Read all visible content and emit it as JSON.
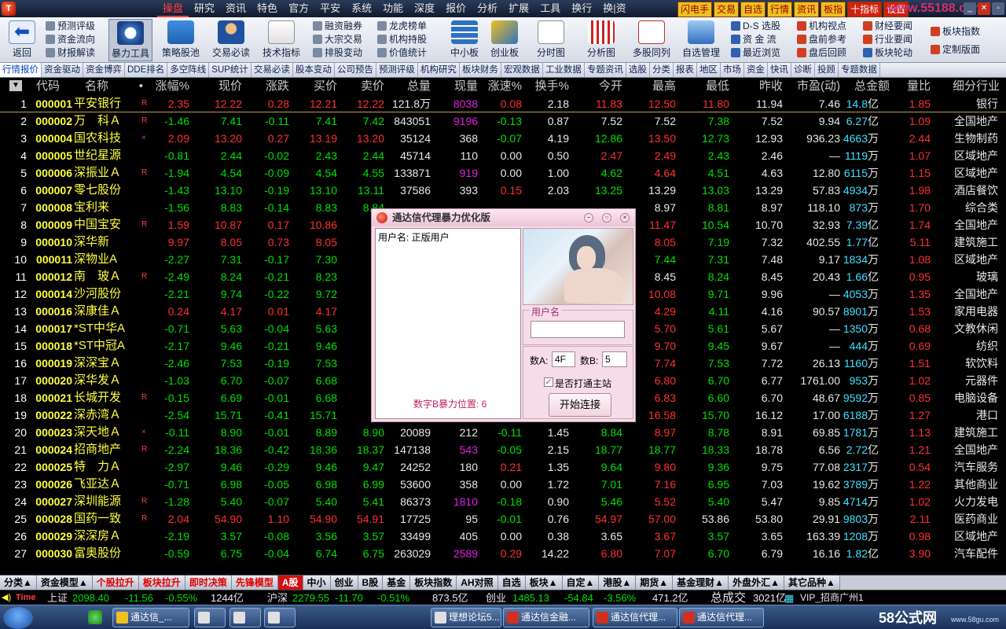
{
  "menu": {
    "items": [
      "操盘",
      "研究",
      "资讯",
      "特色",
      "官方",
      "平安",
      "系统",
      "功能",
      "深度",
      "报价",
      "分析",
      "扩展",
      "工具",
      "换行",
      "换|资"
    ],
    "quick": [
      "闪电手",
      "交易",
      "自选",
      "行情",
      "资讯",
      "板指",
      "十指标",
      "设置"
    ],
    "watermark": "www.55188.com"
  },
  "toolbar": {
    "back": "返回",
    "violence": "暴力工具",
    "strategy": "策略股池",
    "trade": "交易必读",
    "tech": "技术指标",
    "small1": [
      "预测评级",
      "资金流向",
      "财报解读"
    ],
    "small2": [
      "融资融券",
      "大宗交易",
      "排股变动"
    ],
    "small3": [
      "龙虎榜单",
      "机构持股",
      "价值统计"
    ],
    "zxb": "中小板",
    "cyb": "创业板",
    "fst": "分时图",
    "fxt": "分析图",
    "dgtl": "多股同列",
    "zxgl": "自选管理",
    "small4": [
      "D-S 选股",
      "资 金 流",
      "最近浏览"
    ],
    "small5": [
      "机构视点",
      "盘前参考",
      "盘后回顾"
    ],
    "small6": [
      "财经要闻",
      "行业要闻",
      "板块轮动"
    ],
    "small7": [
      "板块指数",
      "定制版面"
    ]
  },
  "tabs": [
    "行情报价",
    "资金驱动",
    "资金博弈",
    "DDE排名",
    "多空阵线",
    "SUP统计",
    "交易必读",
    "股本变动",
    "公司预告",
    "预测评级",
    "机构研究",
    "板块财务",
    "宏观数据",
    "工业数据",
    "专题资讯",
    "选股",
    "分类",
    "报表",
    "地区",
    "市场",
    "资金",
    "快讯",
    "诊断",
    "投顾",
    "专题数据"
  ],
  "table": {
    "headers": [
      "代码",
      "名称",
      "•",
      "涨幅%",
      "现价",
      "涨跌",
      "买价",
      "卖价",
      "总量",
      "现量",
      "涨速%",
      "换手%",
      "今开",
      "最高",
      "最低",
      "昨收",
      "市盈(动)",
      "总金额",
      "量比",
      "细分行业"
    ],
    "rows": [
      {
        "no": "1",
        "code": "000001",
        "name": "平安银行",
        "flag": "R",
        "d": "up",
        "pct": "2.35",
        "price": "12.22",
        "chg": "0.28",
        "bid": "12.21",
        "ask": "12.22",
        "vol": "121.8万",
        "cur": "8038",
        "cc": "mag",
        "spd": "0.08",
        "sc": "up",
        "turn": "2.18",
        "open": "11.83",
        "oc": "up",
        "high": "12.50",
        "hc": "up",
        "low": "11.80",
        "lc": "up",
        "prev": "11.94",
        "pe": "7.46",
        "amt": "14.8",
        "amtu": "亿",
        "qr": "1.85",
        "ind": "银行"
      },
      {
        "no": "2",
        "code": "000002",
        "name": "万　科Ａ",
        "flag": "R",
        "d": "dn",
        "pct": "-1.46",
        "price": "7.41",
        "chg": "-0.11",
        "bid": "7.41",
        "ask": "7.42",
        "vol": "843051",
        "cur": "9196",
        "cc": "mag",
        "spd": "-0.13",
        "sc": "dn",
        "turn": "0.87",
        "open": "7.52",
        "oc": "fl",
        "high": "7.52",
        "hc": "fl",
        "low": "7.38",
        "lc": "dn",
        "prev": "7.52",
        "pe": "9.94",
        "amt": "6.27",
        "amtu": "亿",
        "qr": "1.09",
        "ind": "全国地产"
      },
      {
        "no": "3",
        "code": "000004",
        "name": "国农科技",
        "flag": "×",
        "d": "up",
        "pct": "2.09",
        "price": "13.20",
        "chg": "0.27",
        "bid": "13.19",
        "ask": "13.20",
        "vol": "35124",
        "cur": "368",
        "cc": "fl",
        "spd": "-0.07",
        "sc": "dn",
        "turn": "4.19",
        "open": "12.86",
        "oc": "dn",
        "high": "13.50",
        "hc": "up",
        "low": "12.73",
        "lc": "dn",
        "prev": "12.93",
        "pe": "936.23",
        "amt": "4663",
        "amtu": "万",
        "qr": "2.44",
        "ind": "生物制药"
      },
      {
        "no": "4",
        "code": "000005",
        "name": "世纪星源",
        "flag": "",
        "d": "dn",
        "pct": "-0.81",
        "price": "2.44",
        "chg": "-0.02",
        "bid": "2.43",
        "ask": "2.44",
        "vol": "45714",
        "cur": "110",
        "cc": "fl",
        "spd": "0.00",
        "sc": "fl",
        "turn": "0.50",
        "open": "2.47",
        "oc": "up",
        "high": "2.49",
        "hc": "up",
        "low": "2.43",
        "lc": "dn",
        "prev": "2.46",
        "pe": "—",
        "amt": "1119",
        "amtu": "万",
        "qr": "1.07",
        "ind": "区域地产"
      },
      {
        "no": "5",
        "code": "000006",
        "name": "深振业Ａ",
        "flag": "R",
        "d": "dn",
        "pct": "-1.94",
        "price": "4.54",
        "chg": "-0.09",
        "bid": "4.54",
        "ask": "4.55",
        "vol": "133871",
        "cur": "919",
        "cc": "mag",
        "spd": "0.00",
        "sc": "fl",
        "turn": "1.00",
        "open": "4.62",
        "oc": "dn",
        "high": "4.64",
        "hc": "up",
        "low": "4.51",
        "lc": "dn",
        "prev": "4.63",
        "pe": "12.80",
        "amt": "6115",
        "amtu": "万",
        "qr": "1.15",
        "ind": "区域地产"
      },
      {
        "no": "6",
        "code": "000007",
        "name": "零七股份",
        "flag": "",
        "d": "dn",
        "pct": "-1.43",
        "price": "13.10",
        "chg": "-0.19",
        "bid": "13.10",
        "ask": "13.11",
        "vol": "37586",
        "cur": "393",
        "cc": "fl",
        "spd": "0.15",
        "sc": "up",
        "turn": "2.03",
        "open": "13.25",
        "oc": "dn",
        "high": "13.29",
        "hc": "fl",
        "low": "13.03",
        "lc": "dn",
        "prev": "13.29",
        "pe": "57.83",
        "amt": "4934",
        "amtu": "万",
        "qr": "1.98",
        "ind": "酒店餐饮"
      },
      {
        "no": "7",
        "code": "000008",
        "name": "宝利来",
        "flag": "",
        "d": "dn",
        "pct": "-1.56",
        "price": "8.83",
        "chg": "-0.14",
        "bid": "8.83",
        "ask": "8.84",
        "vol": "",
        "cur": "",
        "cc": "fl",
        "spd": "",
        "sc": "fl",
        "turn": "",
        "open": "",
        "oc": "fl",
        "high": "8.97",
        "hc": "fl",
        "low": "8.81",
        "lc": "dn",
        "prev": "8.97",
        "pe": "118.10",
        "amt": "873",
        "amtu": "万",
        "qr": "1.70",
        "ind": "综合类"
      },
      {
        "no": "8",
        "code": "000009",
        "name": "中国宝安",
        "flag": "R",
        "d": "up",
        "pct": "1.59",
        "price": "10.87",
        "chg": "0.17",
        "bid": "10.86",
        "ask": "",
        "vol": "",
        "cur": "",
        "cc": "fl",
        "spd": "",
        "sc": "fl",
        "turn": "",
        "open": "",
        "oc": "fl",
        "high": "11.47",
        "hc": "up",
        "low": "10.54",
        "lc": "dn",
        "prev": "10.70",
        "pe": "32.93",
        "amt": "7.39",
        "amtu": "亿",
        "qr": "1.74",
        "ind": "全国地产"
      },
      {
        "no": "9",
        "code": "000010",
        "name": "深华新",
        "flag": "",
        "d": "up",
        "pct": "9.97",
        "price": "8.05",
        "chg": "0.73",
        "bid": "8.05",
        "ask": "",
        "vol": "",
        "cur": "",
        "cc": "fl",
        "spd": "",
        "sc": "fl",
        "turn": "",
        "open": "",
        "oc": "fl",
        "high": "8.05",
        "hc": "up",
        "low": "7.19",
        "lc": "dn",
        "prev": "7.32",
        "pe": "402.55",
        "amt": "1.77",
        "amtu": "亿",
        "qr": "5.11",
        "ind": "建筑施工"
      },
      {
        "no": "10",
        "code": "000011",
        "name": "深物业A",
        "flag": "",
        "d": "dn",
        "pct": "-2.27",
        "price": "7.31",
        "chg": "-0.17",
        "bid": "7.30",
        "ask": "",
        "vol": "",
        "cur": "",
        "cc": "fl",
        "spd": "",
        "sc": "fl",
        "turn": "",
        "open": "",
        "oc": "fl",
        "high": "7.44",
        "hc": "dn",
        "low": "7.31",
        "lc": "dn",
        "prev": "7.48",
        "pe": "9.17",
        "amt": "1834",
        "amtu": "万",
        "qr": "1.08",
        "ind": "区域地产"
      },
      {
        "no": "11",
        "code": "000012",
        "name": "南　玻Ａ",
        "flag": "R",
        "d": "dn",
        "pct": "-2.49",
        "price": "8.24",
        "chg": "-0.21",
        "bid": "8.23",
        "ask": "",
        "vol": "",
        "cur": "",
        "cc": "fl",
        "spd": "",
        "sc": "fl",
        "turn": "",
        "open": "",
        "oc": "fl",
        "high": "8.45",
        "hc": "fl",
        "low": "8.24",
        "lc": "dn",
        "prev": "8.45",
        "pe": "20.43",
        "amt": "1.66",
        "amtu": "亿",
        "qr": "0.95",
        "ind": "玻璃"
      },
      {
        "no": "12",
        "code": "000014",
        "name": "沙河股份",
        "flag": "",
        "d": "dn",
        "pct": "-2.21",
        "price": "9.74",
        "chg": "-0.22",
        "bid": "9.72",
        "ask": "",
        "vol": "",
        "cur": "",
        "cc": "fl",
        "spd": "",
        "sc": "fl",
        "turn": "",
        "open": "",
        "oc": "fl",
        "high": "10.08",
        "hc": "up",
        "low": "9.71",
        "lc": "dn",
        "prev": "9.96",
        "pe": "—",
        "amt": "4053",
        "amtu": "万",
        "qr": "1.35",
        "ind": "全国地产"
      },
      {
        "no": "13",
        "code": "000016",
        "name": "深康佳Ａ",
        "flag": "",
        "d": "up",
        "pct": "0.24",
        "price": "4.17",
        "chg": "0.01",
        "bid": "4.17",
        "ask": "",
        "vol": "",
        "cur": "",
        "cc": "fl",
        "spd": "",
        "sc": "fl",
        "turn": "",
        "open": "",
        "oc": "fl",
        "high": "4.29",
        "hc": "up",
        "low": "4.11",
        "lc": "dn",
        "prev": "4.16",
        "pe": "90.57",
        "amt": "8901",
        "amtu": "万",
        "qr": "1.53",
        "ind": "家用电器"
      },
      {
        "no": "14",
        "code": "000017",
        "name": "*ST中华A",
        "flag": "",
        "d": "dn",
        "pct": "-0.71",
        "price": "5.63",
        "chg": "-0.04",
        "bid": "5.63",
        "ask": "",
        "vol": "",
        "cur": "",
        "cc": "fl",
        "spd": "",
        "sc": "fl",
        "turn": "",
        "open": "",
        "oc": "fl",
        "high": "5.70",
        "hc": "up",
        "low": "5.61",
        "lc": "dn",
        "prev": "5.67",
        "pe": "—",
        "amt": "1350",
        "amtu": "万",
        "qr": "0.68",
        "ind": "文教休闲"
      },
      {
        "no": "15",
        "code": "000018",
        "name": "*ST中冠A",
        "flag": "",
        "d": "dn",
        "pct": "-2.17",
        "price": "9.46",
        "chg": "-0.21",
        "bid": "9.46",
        "ask": "",
        "vol": "",
        "cur": "",
        "cc": "fl",
        "spd": "",
        "sc": "fl",
        "turn": "",
        "open": "",
        "oc": "fl",
        "high": "9.70",
        "hc": "up",
        "low": "9.45",
        "lc": "dn",
        "prev": "9.67",
        "pe": "—",
        "amt": "444",
        "amtu": "万",
        "qr": "0.69",
        "ind": "纺织"
      },
      {
        "no": "16",
        "code": "000019",
        "name": "深深宝Ａ",
        "flag": "",
        "d": "dn",
        "pct": "-2.46",
        "price": "7.53",
        "chg": "-0.19",
        "bid": "7.53",
        "ask": "",
        "vol": "",
        "cur": "",
        "cc": "fl",
        "spd": "",
        "sc": "fl",
        "turn": "",
        "open": "",
        "oc": "fl",
        "high": "7.74",
        "hc": "up",
        "low": "7.53",
        "lc": "dn",
        "prev": "7.72",
        "pe": "26.13",
        "amt": "1160",
        "amtu": "万",
        "qr": "1.51",
        "ind": "软饮料"
      },
      {
        "no": "17",
        "code": "000020",
        "name": "深华发Ａ",
        "flag": "",
        "d": "dn",
        "pct": "-1.03",
        "price": "6.70",
        "chg": "-0.07",
        "bid": "6.68",
        "ask": "",
        "vol": "",
        "cur": "",
        "cc": "fl",
        "spd": "",
        "sc": "fl",
        "turn": "",
        "open": "",
        "oc": "fl",
        "high": "6.80",
        "hc": "up",
        "low": "6.70",
        "lc": "dn",
        "prev": "6.77",
        "pe": "1761.00",
        "amt": "953",
        "amtu": "万",
        "qr": "1.02",
        "ind": "元器件"
      },
      {
        "no": "18",
        "code": "000021",
        "name": "长城开发",
        "flag": "R",
        "d": "dn",
        "pct": "-0.15",
        "price": "6.69",
        "chg": "-0.01",
        "bid": "6.68",
        "ask": "",
        "vol": "",
        "cur": "",
        "cc": "fl",
        "spd": "",
        "sc": "fl",
        "turn": "",
        "open": "",
        "oc": "fl",
        "high": "6.83",
        "hc": "up",
        "low": "6.60",
        "lc": "dn",
        "prev": "6.70",
        "pe": "48.67",
        "amt": "9592",
        "amtu": "万",
        "qr": "0.85",
        "ind": "电脑设备"
      },
      {
        "no": "19",
        "code": "000022",
        "name": "深赤湾Ａ",
        "flag": "",
        "d": "dn",
        "pct": "-2.54",
        "price": "15.71",
        "chg": "-0.41",
        "bid": "15.71",
        "ask": "",
        "vol": "",
        "cur": "",
        "cc": "fl",
        "spd": "",
        "sc": "fl",
        "turn": "",
        "open": "",
        "oc": "fl",
        "high": "16.58",
        "hc": "up",
        "low": "15.70",
        "lc": "dn",
        "prev": "16.12",
        "pe": "17.00",
        "amt": "6188",
        "amtu": "万",
        "qr": "1.27",
        "ind": "港口"
      },
      {
        "no": "20",
        "code": "000023",
        "name": "深天地Ａ",
        "flag": "×",
        "d": "dn",
        "pct": "-0.11",
        "price": "8.90",
        "chg": "-0.01",
        "bid": "8.89",
        "ask": "8.90",
        "vol": "20089",
        "cur": "212",
        "cc": "fl",
        "spd": "-0.11",
        "sc": "dn",
        "turn": "1.45",
        "open": "8.84",
        "oc": "dn",
        "high": "8.97",
        "hc": "up",
        "low": "8.78",
        "lc": "dn",
        "prev": "8.91",
        "pe": "69.85",
        "amt": "1781",
        "amtu": "万",
        "qr": "1.13",
        "ind": "建筑施工"
      },
      {
        "no": "21",
        "code": "000024",
        "name": "招商地产",
        "flag": "R",
        "d": "dn",
        "pct": "-2.24",
        "price": "18.36",
        "chg": "-0.42",
        "bid": "18.36",
        "ask": "18.37",
        "vol": "147138",
        "cur": "543",
        "cc": "mag",
        "spd": "-0.05",
        "sc": "dn",
        "turn": "2.15",
        "open": "18.77",
        "oc": "dn",
        "high": "18.77",
        "hc": "dn",
        "low": "18.33",
        "lc": "dn",
        "prev": "18.78",
        "pe": "6.56",
        "amt": "2.72",
        "amtu": "亿",
        "qr": "1.21",
        "ind": "全国地产"
      },
      {
        "no": "22",
        "code": "000025",
        "name": "特　力Ａ",
        "flag": "",
        "d": "dn",
        "pct": "-2.97",
        "price": "9.46",
        "chg": "-0.29",
        "bid": "9.46",
        "ask": "9.47",
        "vol": "24252",
        "cur": "180",
        "cc": "fl",
        "spd": "0.21",
        "sc": "up",
        "turn": "1.35",
        "open": "9.64",
        "oc": "dn",
        "high": "9.80",
        "hc": "up",
        "low": "9.36",
        "lc": "dn",
        "prev": "9.75",
        "pe": "77.08",
        "amt": "2317",
        "amtu": "万",
        "qr": "0.54",
        "ind": "汽车服务"
      },
      {
        "no": "23",
        "code": "000026",
        "name": "飞亚达Ａ",
        "flag": "",
        "d": "dn",
        "pct": "-0.71",
        "price": "6.98",
        "chg": "-0.05",
        "bid": "6.98",
        "ask": "6.99",
        "vol": "53600",
        "cur": "358",
        "cc": "fl",
        "spd": "0.00",
        "sc": "fl",
        "turn": "1.72",
        "open": "7.01",
        "oc": "dn",
        "high": "7.16",
        "hc": "up",
        "low": "6.95",
        "lc": "dn",
        "prev": "7.03",
        "pe": "19.62",
        "amt": "3789",
        "amtu": "万",
        "qr": "1.22",
        "ind": "其他商业"
      },
      {
        "no": "24",
        "code": "000027",
        "name": "深圳能源",
        "flag": "R",
        "d": "dn",
        "pct": "-1.28",
        "price": "5.40",
        "chg": "-0.07",
        "bid": "5.40",
        "ask": "5.41",
        "vol": "86373",
        "cur": "1810",
        "cc": "mag",
        "spd": "-0.18",
        "sc": "dn",
        "turn": "0.90",
        "open": "5.46",
        "oc": "dn",
        "high": "5.52",
        "hc": "up",
        "low": "5.40",
        "lc": "dn",
        "prev": "5.47",
        "pe": "9.85",
        "amt": "4714",
        "amtu": "万",
        "qr": "1.02",
        "ind": "火力发电"
      },
      {
        "no": "25",
        "code": "000028",
        "name": "国药一致",
        "flag": "R",
        "d": "up",
        "pct": "2.04",
        "price": "54.90",
        "chg": "1.10",
        "bid": "54.90",
        "ask": "54.91",
        "vol": "17725",
        "cur": "95",
        "cc": "fl",
        "spd": "-0.01",
        "sc": "dn",
        "turn": "0.76",
        "open": "54.97",
        "oc": "up",
        "high": "57.00",
        "hc": "up",
        "low": "53.86",
        "lc": "fl",
        "prev": "53.80",
        "pe": "29.91",
        "amt": "9803",
        "amtu": "万",
        "qr": "2.11",
        "ind": "医药商业"
      },
      {
        "no": "26",
        "code": "000029",
        "name": "深深房Ａ",
        "flag": "",
        "d": "dn",
        "pct": "-2.19",
        "price": "3.57",
        "chg": "-0.08",
        "bid": "3.56",
        "ask": "3.57",
        "vol": "33499",
        "cur": "405",
        "cc": "fl",
        "spd": "0.00",
        "sc": "fl",
        "turn": "0.38",
        "open": "3.65",
        "oc": "fl",
        "high": "3.67",
        "hc": "up",
        "low": "3.57",
        "lc": "dn",
        "prev": "3.65",
        "pe": "163.39",
        "amt": "1208",
        "amtu": "万",
        "qr": "0.98",
        "ind": "区域地产"
      },
      {
        "no": "27",
        "code": "000030",
        "name": "富奥股份",
        "flag": "",
        "d": "dn",
        "pct": "-0.59",
        "price": "6.75",
        "chg": "-0.04",
        "bid": "6.74",
        "ask": "6.75",
        "vol": "263029",
        "cur": "2589",
        "cc": "mag",
        "spd": "0.29",
        "sc": "up",
        "turn": "14.22",
        "open": "6.80",
        "oc": "up",
        "high": "7.07",
        "hc": "up",
        "low": "6.70",
        "lc": "dn",
        "prev": "6.79",
        "pe": "16.16",
        "amt": "1.82",
        "amtu": "亿",
        "qr": "3.90",
        "ind": "汽车配件"
      }
    ]
  },
  "dialog": {
    "title": "通达信代理暴力优化版",
    "user_line": "用户名: 正版用户",
    "position": "数字B暴力位置: 6",
    "user_group": "用户名",
    "a_label": "数A:",
    "a_value": "4F",
    "b_label": "数B:",
    "b_value": "5",
    "checkbox_label": "是否打通主站",
    "connect": "开始连接"
  },
  "mktbar": [
    "分类▲",
    "资金模型▲",
    "个股拉升",
    "板块拉升",
    "即时决策",
    "先锋模型",
    "A股",
    "中小",
    "创业",
    "B股",
    "基金",
    "板块指数",
    "AH对照",
    "自选",
    "板块▲",
    "自定▲",
    "港股▲",
    "期货▲",
    "基金理财▲",
    "外盘外汇▲",
    "其它品种▲"
  ],
  "status": {
    "time": "Time",
    "sh_label": "上证",
    "sh_val": "2098.40",
    "sh_chg": "-11.56",
    "sh_pct": "-0.55%",
    "sh_amt": "1244亿",
    "sz_label": "沪深",
    "sz_val": "2279.55",
    "sz_chg": "-11.70",
    "sz_pct": "-0.51%",
    "sz_amt": "873.5亿",
    "cy_label": "创业",
    "cy_val": "1485.13",
    "cy_chg": "-54.84",
    "cy_pct": "-3.56%",
    "cy_amt": "471.2亿",
    "total_label": "总成交",
    "total": "3021亿",
    "vip": "VIP_招商广州1"
  },
  "taskbar": {
    "tasks": [
      "通达信_...",
      "",
      "",
      "",
      "理想论坛5...",
      "通达信金融...",
      "通达信代理...",
      "通达信代理..."
    ],
    "brand": "58公式网",
    "brand_url": "www.58gu.com"
  }
}
